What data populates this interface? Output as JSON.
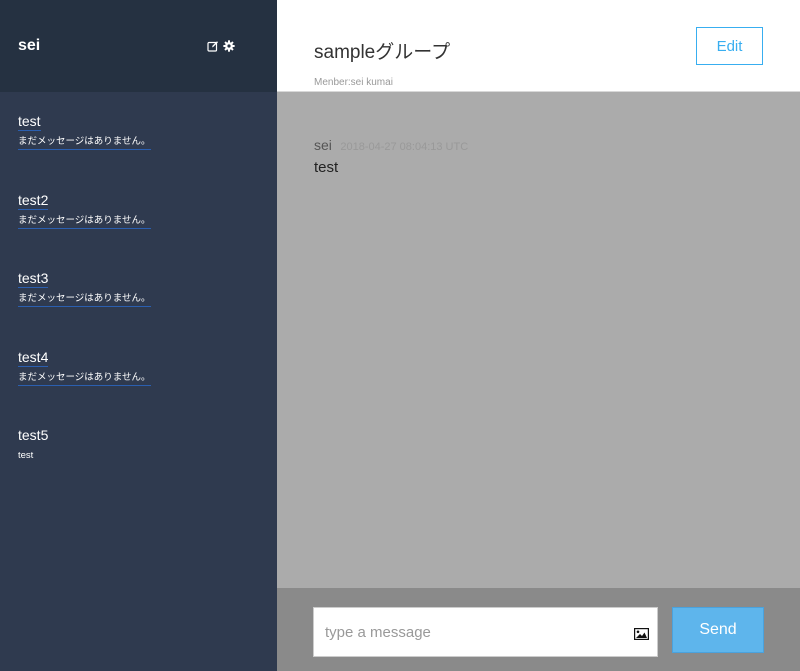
{
  "sidebar": {
    "user_name": "sei",
    "header_icons": [
      "edit-icon",
      "gear-icon"
    ],
    "groups": [
      {
        "name": "test",
        "last_message": "まだメッセージはありません。"
      },
      {
        "name": "test2",
        "last_message": "まだメッセージはありません。"
      },
      {
        "name": "test3",
        "last_message": "まだメッセージはありません。"
      },
      {
        "name": "test4",
        "last_message": "まだメッセージはありません。"
      },
      {
        "name": "test5",
        "last_message": "test"
      }
    ]
  },
  "main": {
    "group_title": "sampleグループ",
    "members": "Menber:sei kumai",
    "edit_label": "Edit",
    "messages": [
      {
        "user": "sei",
        "date": "2018-04-27 08:04:13 UTC",
        "text": "test"
      }
    ],
    "form": {
      "placeholder": "type a message",
      "value": "",
      "image_icon": "image-icon",
      "send_label": "Send"
    }
  },
  "colors": {
    "sidebar_bg": "#2f3a4f",
    "sidebar_header_bg": "#253141",
    "accent": "#38aef0",
    "send_button": "#5eb5ec",
    "messages_bg": "#ababab",
    "form_bg": "#8a8a8a"
  }
}
